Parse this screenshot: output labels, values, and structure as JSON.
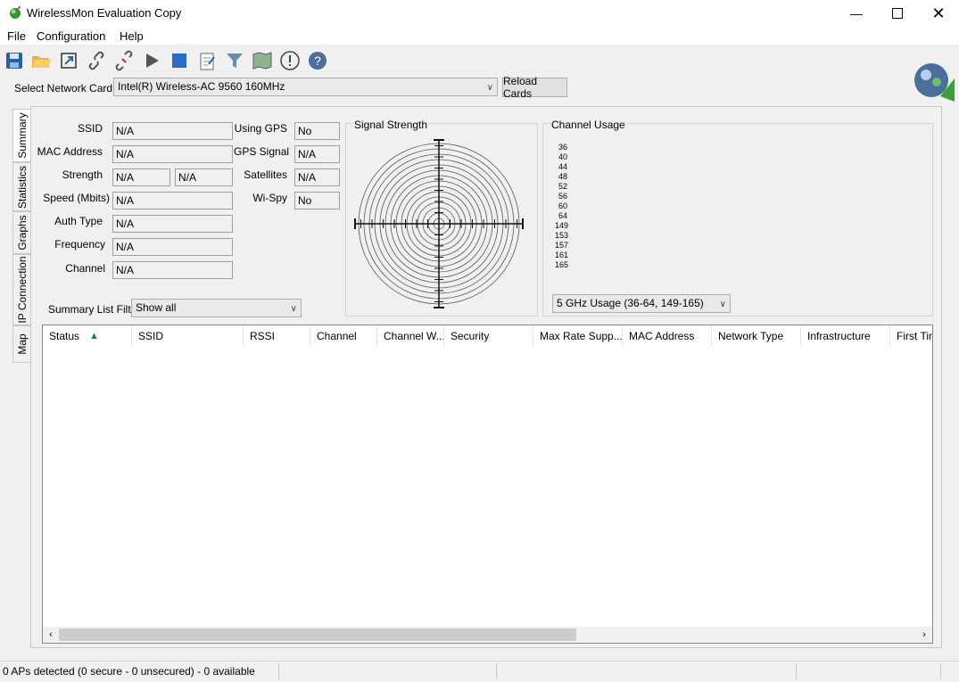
{
  "window": {
    "title": "WirelessMon Evaluation Copy"
  },
  "menu": [
    "File",
    "Configuration",
    "Help"
  ],
  "toolbar": {
    "items": [
      "save-icon",
      "open-folder-icon",
      "export-icon",
      "link-icon",
      "disconnect-icon",
      "play-icon",
      "stop-icon",
      "notepad-icon",
      "filter-icon",
      "map-icon",
      "alert-icon",
      "help-icon"
    ]
  },
  "network": {
    "label": "Select Network Card",
    "card": "Intel(R) Wireless-AC 9560 160MHz",
    "reload": "Reload Cards"
  },
  "tabs": [
    "Summary",
    "Statistics",
    "Graphs",
    "IP Connection",
    "Map"
  ],
  "summary": {
    "ssid_label": "SSID",
    "ssid": "N/A",
    "mac_label": "MAC Address",
    "mac": "N/A",
    "strength_label": "Strength",
    "strength1": "N/A",
    "strength2": "N/A",
    "speed_label": "Speed (Mbits)",
    "speed": "N/A",
    "auth_label": "Auth Type",
    "auth": "N/A",
    "freq_label": "Frequency",
    "freq": "N/A",
    "channel_label": "Channel",
    "channel": "N/A",
    "gps_label": "Using GPS",
    "gps": "No",
    "gps_signal_label": "GPS Signal",
    "gps_signal": "N/A",
    "sat_label": "Satellites",
    "sat": "N/A",
    "wispy_label": "Wi-Spy",
    "wispy": "No",
    "filter_label": "Summary List Filter:",
    "filter": "Show all"
  },
  "signal": {
    "title": "Signal Strength"
  },
  "channel_usage": {
    "title": "Channel Usage",
    "channels": [
      "36",
      "40",
      "44",
      "48",
      "52",
      "56",
      "60",
      "64",
      "149",
      "153",
      "157",
      "161",
      "165"
    ],
    "band": "5 GHz Usage (36-64, 149-165)"
  },
  "list": {
    "columns": [
      "Status",
      "SSID",
      "RSSI",
      "Channel",
      "Channel W...",
      "Security",
      "Max Rate Supp...",
      "MAC Address",
      "Network Type",
      "Infrastructure",
      "First Tim"
    ]
  },
  "status": {
    "text": "0 APs detected (0 secure - 0 unsecured) - 0 available"
  }
}
